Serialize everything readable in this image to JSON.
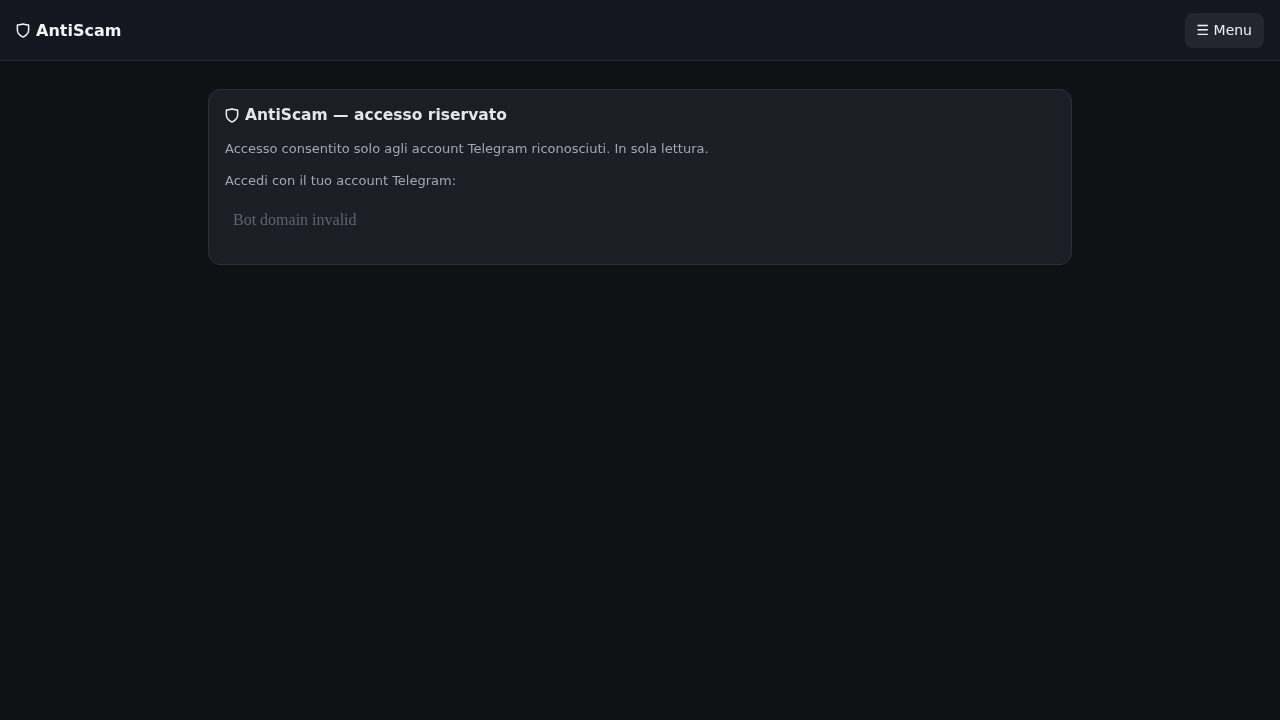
{
  "header": {
    "brand": "AntiScam",
    "menu_button": "☰ Menu"
  },
  "card": {
    "title": "AntiScam — accesso riservato",
    "description": "Accesso consentito solo agli account Telegram riconosciuti. In sola lettura.",
    "login_prompt": "Accedi con il tuo account Telegram:",
    "widget_message": "Bot domain invalid"
  }
}
